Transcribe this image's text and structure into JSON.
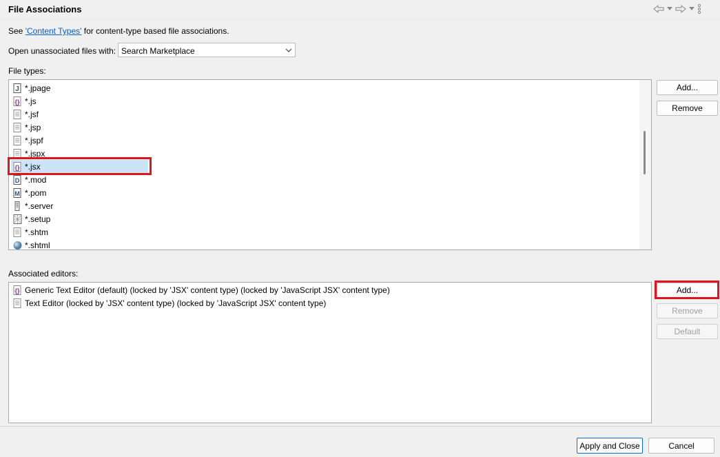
{
  "header": {
    "title": "File Associations"
  },
  "content_types_line": {
    "prefix": "See ",
    "link": "'Content Types'",
    "suffix": " for content-type based file associations."
  },
  "open_unassociated": {
    "label": "Open unassociated files with:",
    "value": "Search Marketplace"
  },
  "file_types": {
    "label": "File types:",
    "items": [
      {
        "label": "*.jpage",
        "icon": "java-file-icon"
      },
      {
        "label": "*.js",
        "icon": "js-file-icon"
      },
      {
        "label": "*.jsf",
        "icon": "text-file-icon"
      },
      {
        "label": "*.jsp",
        "icon": "text-file-icon"
      },
      {
        "label": "*.jspf",
        "icon": "text-file-icon"
      },
      {
        "label": "*.jspx",
        "icon": "text-file-icon"
      },
      {
        "label": "*.jsx",
        "icon": "js-file-icon"
      },
      {
        "label": "*.mod",
        "icon": "d-file-icon"
      },
      {
        "label": "*.pom",
        "icon": "maven-file-icon"
      },
      {
        "label": "*.server",
        "icon": "server-file-icon"
      },
      {
        "label": "*.setup",
        "icon": "setup-file-icon"
      },
      {
        "label": "*.shtm",
        "icon": "text-file-icon"
      },
      {
        "label": "*.shtml",
        "icon": "globe-icon"
      }
    ],
    "selected_label": "*.jsx",
    "add_label": "Add...",
    "remove_label": "Remove"
  },
  "associated_editors": {
    "label": "Associated editors:",
    "items": [
      {
        "label": "Generic Text Editor (default) (locked by 'JSX' content type) (locked by 'JavaScript JSX' content type)",
        "icon": "js-file-icon"
      },
      {
        "label": "Text Editor (locked by 'JSX' content type) (locked by 'JavaScript JSX' content type)",
        "icon": "text-file-icon"
      }
    ],
    "add_label": "Add...",
    "remove_label": "Remove",
    "default_label": "Default"
  },
  "footer": {
    "apply_close_label": "Apply and Close",
    "cancel_label": "Cancel"
  },
  "colors": {
    "highlight": "#e0141f",
    "selection": "#cce4f7",
    "link": "#0a5ec2"
  }
}
